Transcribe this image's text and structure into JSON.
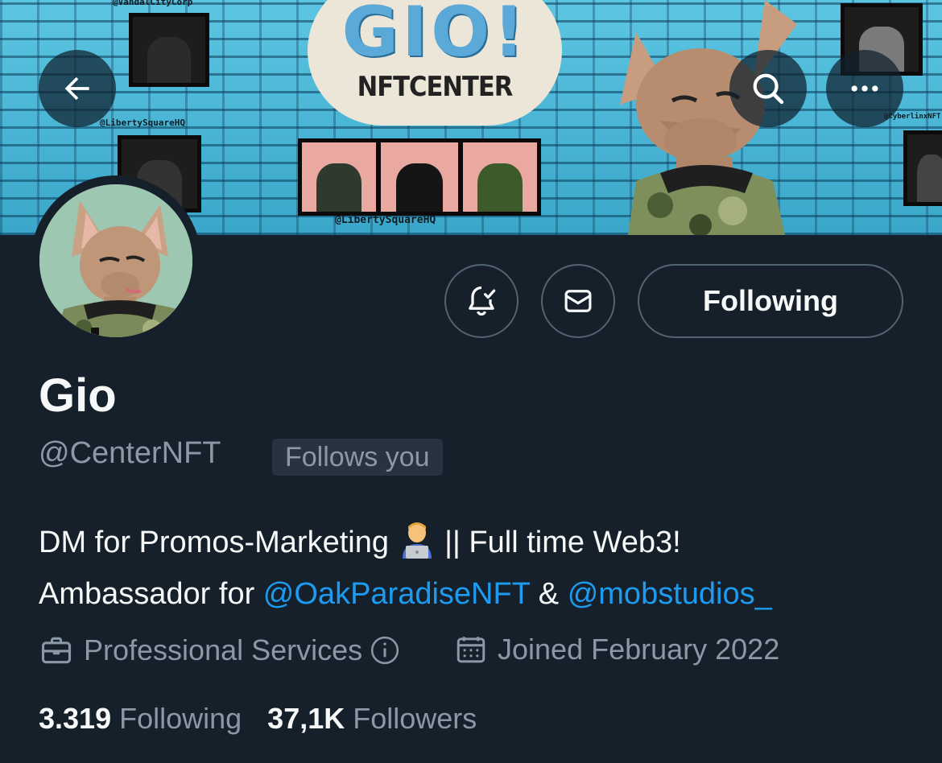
{
  "banner": {
    "logo_title": "GIO!",
    "logo_subtitle": "NFTCENTER",
    "tags": [
      "@VandalCityCorp",
      "@LibertySquareHQ",
      "@LibertySquareHQ",
      "@CyberlinxNFT"
    ]
  },
  "nav": {
    "back_icon": "arrow-left-icon",
    "search_icon": "search-icon",
    "more_icon": "more-horizontal-icon"
  },
  "actions": {
    "notify_icon": "bell-check-icon",
    "message_icon": "envelope-icon",
    "follow_label": "Following"
  },
  "profile": {
    "name": "Gio",
    "handle": "@CenterNFT",
    "follows_you": "Follows you",
    "bio": {
      "line1_text": "DM for Promos-Marketing",
      "line1_after_emoji": "|| Full time Web3!",
      "line2_prefix": "Ambassador for ",
      "mention1": "@OakParadiseNFT",
      "amp": " & ",
      "mention2": "@mobstudios_"
    },
    "category": "Professional Services",
    "joined": "Joined February 2022",
    "following_count": "3.319",
    "following_label": "Following",
    "followers_count": "37,1K",
    "followers_label": "Followers"
  },
  "colors": {
    "background": "#15202b",
    "accent_link": "#1d9bf0",
    "secondary_text": "#8b98a5",
    "border": "#536471"
  }
}
